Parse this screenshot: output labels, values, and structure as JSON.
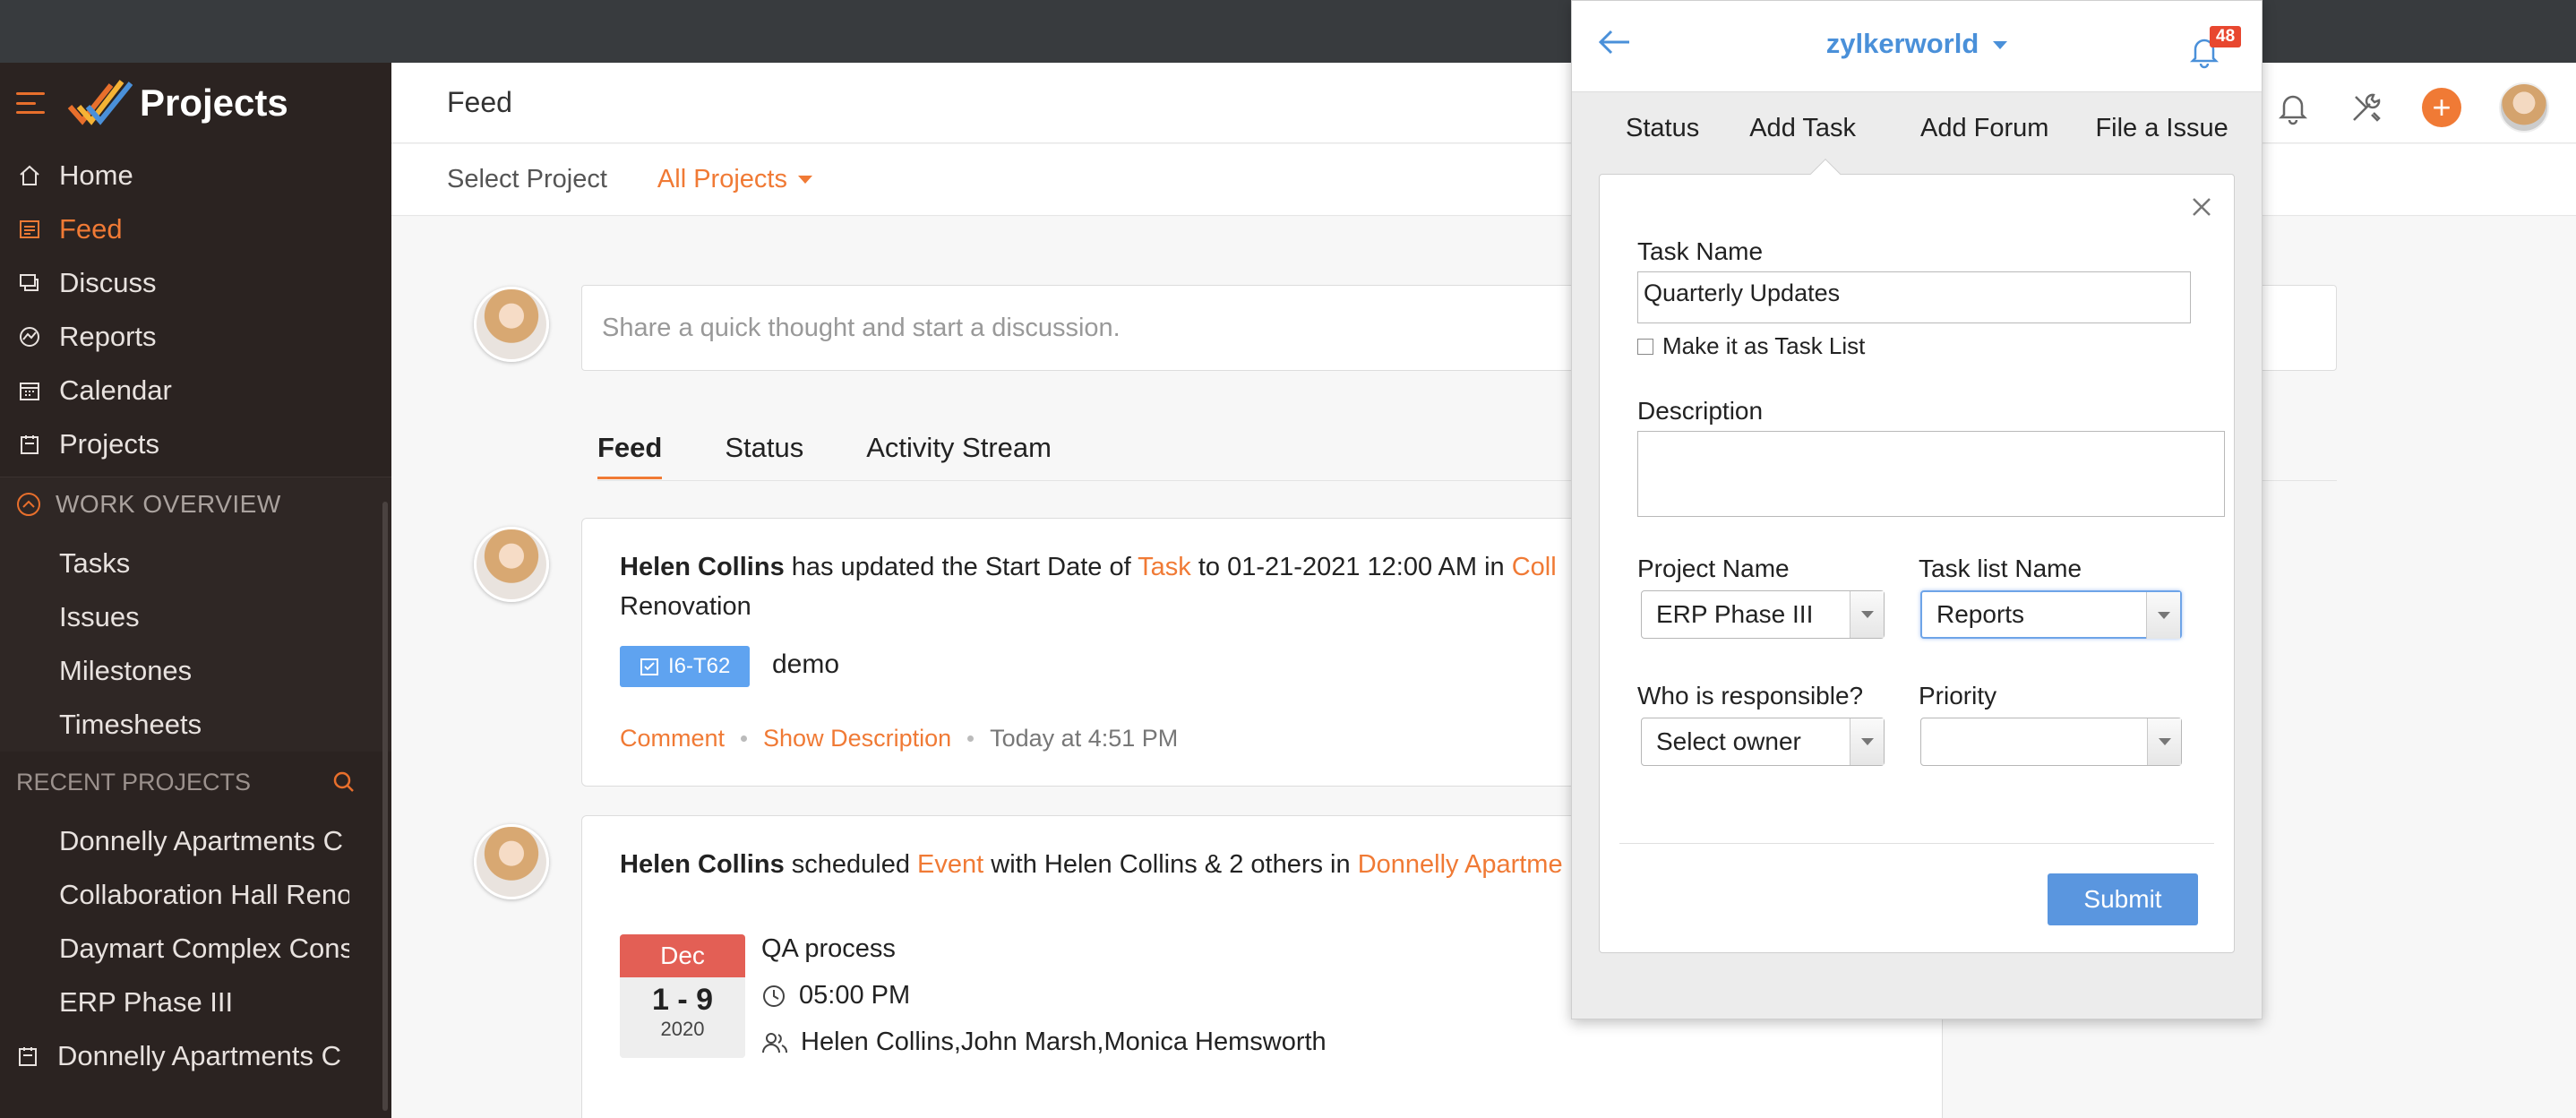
{
  "app": {
    "title": "Projects",
    "brand_colors": {
      "accent": "#f07a35",
      "sidebar": "#2b2321",
      "link_blue": "#4a90d9"
    }
  },
  "sidebar": {
    "nav": [
      {
        "label": "Home",
        "icon": "home-icon"
      },
      {
        "label": "Feed",
        "icon": "feed-icon",
        "active": true
      },
      {
        "label": "Discuss",
        "icon": "discuss-icon"
      },
      {
        "label": "Reports",
        "icon": "reports-icon"
      },
      {
        "label": "Calendar",
        "icon": "calendar-icon"
      },
      {
        "label": "Projects",
        "icon": "projects-icon"
      }
    ],
    "work_overview": {
      "title": "WORK OVERVIEW",
      "items": [
        "Tasks",
        "Issues",
        "Milestones",
        "Timesheets"
      ]
    },
    "recent_projects": {
      "title": "RECENT PROJECTS",
      "items": [
        "Donnelly Apartments C",
        "Collaboration Hall Reno",
        "Daymart Complex Cons",
        "ERP Phase III",
        "Donnelly Apartments C"
      ]
    }
  },
  "header": {
    "page_title": "Feed",
    "select_project_label": "Select Project",
    "project_filter": "All Projects"
  },
  "feed": {
    "share_placeholder": "Share a quick thought and start a discussion.",
    "tabs": [
      "Feed",
      "Status",
      "Activity Stream"
    ],
    "item1": {
      "user": "Helen Collins",
      "text1": " has updated the Start Date of ",
      "link1": "Task",
      "text2": " to 01-21-2021 12:00 AM in ",
      "link2": "Coll",
      "line2": "Renovation",
      "tag": "I6-T62",
      "task": "demo",
      "comment": "Comment",
      "show_desc": "Show Description",
      "time": "Today at 4:51 PM"
    },
    "item2": {
      "user": "Helen Collins",
      "text1": " scheduled ",
      "link1": "Event",
      "text2": " with Helen Collins & 2 others in ",
      "link2": "Donnelly Apartme",
      "cal_month": "Dec",
      "cal_days": "1 - 9",
      "cal_year": "2020",
      "event_title": "QA process",
      "event_time": "05:00 PM",
      "attendees": "Helen Collins,John Marsh,Monica Hemsworth"
    }
  },
  "popup": {
    "org": "zylkerworld",
    "notif_count": "48",
    "tabs": [
      "Status",
      "Add Task",
      "Add Forum",
      "File a Issue"
    ],
    "form": {
      "task_name_label": "Task Name",
      "task_name_value": "Quarterly Updates",
      "task_list_checkbox": "Make it as Task List",
      "description_label": "Description",
      "description_value": "",
      "project_name_label": "Project Name",
      "project_name_value": "ERP Phase III",
      "task_list_label": "Task list Name",
      "task_list_value": "Reports",
      "owner_label": "Who is responsible?",
      "owner_value": "Select owner",
      "priority_label": "Priority",
      "priority_value": "",
      "submit": "Submit"
    }
  }
}
